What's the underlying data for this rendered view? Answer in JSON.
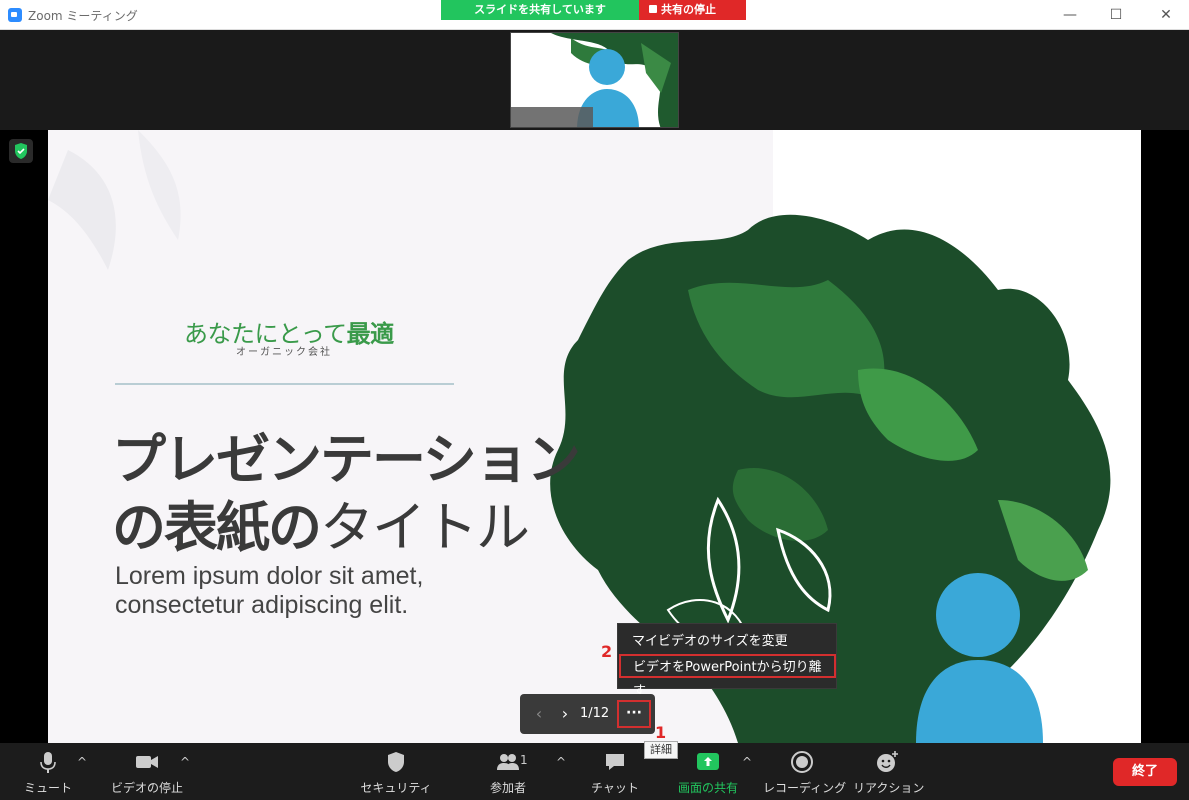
{
  "window": {
    "title": "Zoom ミーティング",
    "minimize": "—",
    "maximize": "☐",
    "close": "✕"
  },
  "share_banner": {
    "status": "スライドを共有しています",
    "stop": "共有の停止"
  },
  "slide": {
    "brand_light": "あなたにとって",
    "brand_bold": "最適",
    "brand_sub": "オーガニック会社",
    "title_line1": "プレゼンテーション",
    "title_line2_bold": "の表紙の",
    "title_line2_light": "タイトル",
    "body_line1": "Lorem ipsum dolor sit amet,",
    "body_line2": "consectetur adipiscing elit."
  },
  "context_menu": {
    "items": [
      {
        "label": "マイビデオのサイズを変更"
      },
      {
        "label": "ビデオをPowerPointから切り離す"
      }
    ]
  },
  "annotations": {
    "step1": "1",
    "step2": "2"
  },
  "slide_control": {
    "page": "1/12",
    "more": "···",
    "tooltip": "詳細"
  },
  "toolbar": {
    "mute": "ミュート",
    "stop_video": "ビデオの停止",
    "security": "セキュリティ",
    "participants": "参加者",
    "participants_count": "1",
    "chat": "チャット",
    "share_screen": "画面の共有",
    "record": "レコーディング",
    "reactions": "リアクション",
    "end": "終了"
  },
  "colors": {
    "share_green": "#22c55e",
    "stop_red": "#e02828",
    "brand_green": "#3a9a4a",
    "silhouette_blue": "#3aa8d8"
  }
}
